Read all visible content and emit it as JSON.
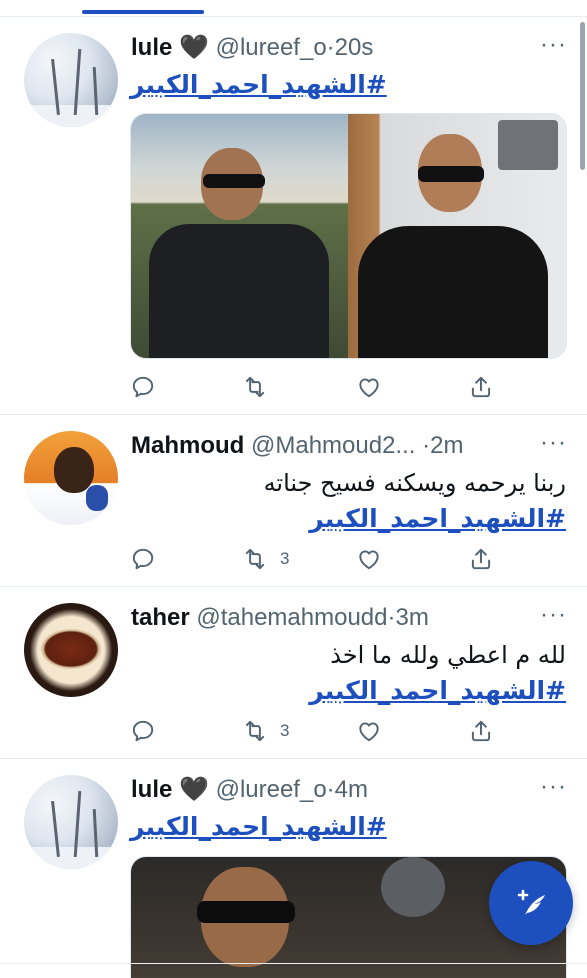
{
  "tabs": {
    "active_indicator": "active-tab"
  },
  "accent_color": "#1d4fbf",
  "tweets": [
    {
      "name": "lule 🖤",
      "handle": "@lureef_o",
      "time": "·20s",
      "more": "···",
      "hashtag": "#الشهيد_احمد_الكبير",
      "text": "",
      "has_media": true,
      "reply_count": "",
      "retweet_count": "",
      "like_count": ""
    },
    {
      "name": "Mahmoud",
      "handle": "@Mahmoud2...",
      "time": "·2m",
      "more": "···",
      "text": "ربنا يرحمه ويسكنه فسيح جناته",
      "hashtag": "#الشهيد_احمد_الكبير",
      "has_media": false,
      "reply_count": "",
      "retweet_count": "3",
      "like_count": ""
    },
    {
      "name": "taher",
      "handle": "@tahemahmoudd",
      "time": "·3m",
      "more": "···",
      "text": "لله م اعطي ولله ما اخذ",
      "hashtag": "#الشهيد_احمد_الكبير",
      "has_media": false,
      "reply_count": "",
      "retweet_count": "3",
      "like_count": ""
    },
    {
      "name": "lule 🖤",
      "handle": "@lureef_o",
      "time": "·4m",
      "more": "···",
      "hashtag": "#الشهيد_احمد_الكبير",
      "text": "",
      "has_media": true,
      "reply_count": "",
      "retweet_count": "",
      "like_count": ""
    }
  ],
  "icons": {
    "reply": "reply-icon",
    "retweet": "retweet-icon",
    "like": "like-icon",
    "share": "share-icon",
    "compose": "compose-tweet-icon",
    "more": "more-icon"
  }
}
